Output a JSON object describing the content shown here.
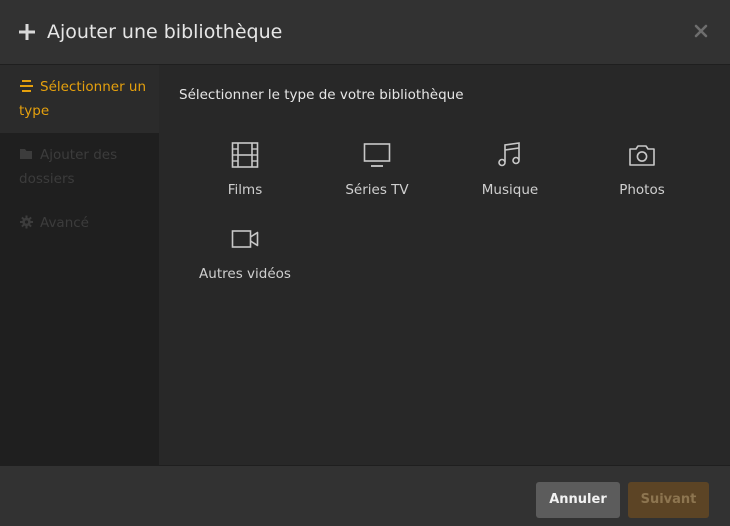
{
  "header": {
    "title": "Ajouter une bibliothèque",
    "plus_icon": "plus-icon",
    "close_icon": "close-icon"
  },
  "sidebar": {
    "items": [
      {
        "label": "Sélectionner un type",
        "icon": "list-icon",
        "state": "active"
      },
      {
        "label": "Ajouter des dossiers",
        "icon": "folder-icon",
        "state": "disabled"
      },
      {
        "label": "Avancé",
        "icon": "gear-icon",
        "state": "disabled"
      }
    ]
  },
  "main": {
    "prompt": "Sélectionner le type de votre bibliothèque",
    "types": [
      {
        "label": "Films",
        "icon": "film-icon"
      },
      {
        "label": "Séries TV",
        "icon": "tv-icon"
      },
      {
        "label": "Musique",
        "icon": "music-icon"
      },
      {
        "label": "Photos",
        "icon": "camera-icon"
      },
      {
        "label": "Autres vidéos",
        "icon": "video-camera-icon"
      }
    ]
  },
  "footer": {
    "cancel_label": "Annuler",
    "next_label": "Suivant"
  },
  "colors": {
    "accent": "#e5a00d",
    "header_bg": "#323232",
    "sidebar_bg": "#1f1f1f",
    "main_bg": "#282828",
    "disabled_text": "#3c3c3c",
    "cancel_bg": "#5c5c5c",
    "next_bg_disabled": "#5c4425"
  }
}
